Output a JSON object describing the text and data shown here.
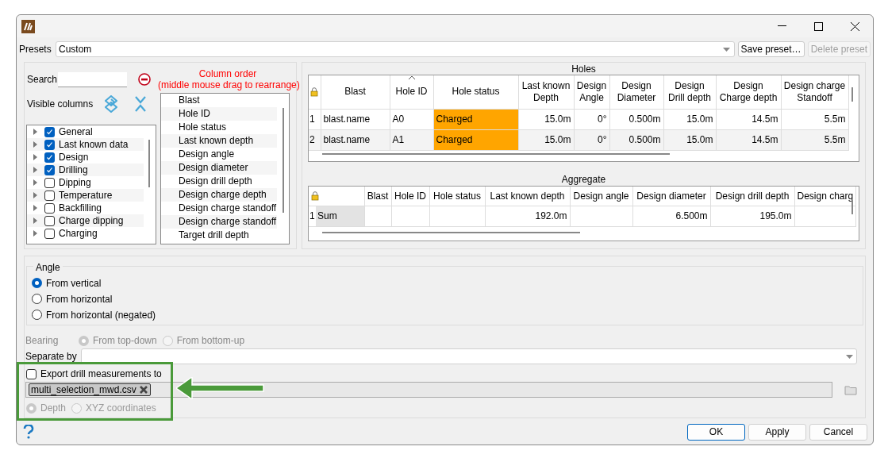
{
  "presets": {
    "label": "Presets",
    "value": "Custom",
    "buttons": [
      {
        "label": "Save preset…",
        "disabled": false
      },
      {
        "label": "Delete preset",
        "disabled": true
      }
    ]
  },
  "column_chooser": {
    "search_label": "Search",
    "visible_label": "Visible columns",
    "order_title": [
      "Column order",
      "(middle mouse drag to rearrange)"
    ],
    "groups": [
      {
        "label": "General",
        "checked": true
      },
      {
        "label": "Last known data",
        "checked": true
      },
      {
        "label": "Design",
        "checked": true
      },
      {
        "label": "Drilling",
        "checked": true
      },
      {
        "label": "Dipping",
        "checked": false
      },
      {
        "label": "Temperature",
        "checked": false
      },
      {
        "label": "Backfilling",
        "checked": false
      },
      {
        "label": "Charge dipping",
        "checked": false
      },
      {
        "label": "Charging",
        "checked": false
      }
    ],
    "order": [
      "Blast",
      "Hole ID",
      "Hole status",
      "Last known depth",
      "Design angle",
      "Design diameter",
      "Design drill depth",
      "Design charge depth",
      "Design charge standoff",
      "Design charge standoff",
      "Target drill depth"
    ]
  },
  "holes": {
    "title": "Holes",
    "columns": [
      {
        "label": "Blast",
        "sorted": false
      },
      {
        "label": "Hole ID",
        "sorted": true
      },
      {
        "label": "Hole status",
        "sorted": false
      },
      {
        "label": "Last known\nDepth",
        "sorted": false
      },
      {
        "label": "Design\nAngle",
        "sorted": false
      },
      {
        "label": "Design\nDiameter",
        "sorted": false
      },
      {
        "label": "Design\nDrill depth",
        "sorted": false
      },
      {
        "label": "Design\nCharge depth",
        "sorted": false
      },
      {
        "label": "Design charge\nStandoff",
        "sorted": false
      }
    ],
    "rows": [
      {
        "index": "1",
        "color": "#ffa500",
        "cells": [
          "blast.name",
          "A0",
          "Charged",
          "15.0m",
          "0°",
          "0.500m",
          "15.0m",
          "14.5m",
          "5.5m"
        ]
      },
      {
        "index": "2",
        "color": "#ffa500",
        "cells": [
          "blast.name",
          "A1",
          "Charged",
          "15.0m",
          "0°",
          "0.500m",
          "15.0m",
          "14.5m",
          "5.5m"
        ]
      }
    ]
  },
  "aggregate": {
    "title": "Aggregate",
    "columns": [
      "Blast",
      "Hole ID",
      "Hole status",
      "Last known depth",
      "Design angle",
      "Design diameter",
      "Design drill depth",
      "Design charg"
    ],
    "rows": [
      {
        "index": "1",
        "label": "Sum",
        "cells": [
          "",
          "",
          "",
          "192.0m",
          "",
          "6.500m",
          "195.0m",
          ""
        ]
      }
    ]
  },
  "angle": {
    "title": "Angle",
    "options": [
      {
        "label": "From vertical",
        "selected": true
      },
      {
        "label": "From horizontal",
        "selected": false
      },
      {
        "label": "From horizontal (negated)",
        "selected": false
      }
    ]
  },
  "bearing": {
    "label": "Bearing",
    "disabled": true,
    "options": [
      {
        "label": "From top-down",
        "selected": true
      },
      {
        "label": "From bottom-up",
        "selected": false
      }
    ]
  },
  "separate_by": {
    "label": "Separate by"
  },
  "export": {
    "label": "Export drill measurements to",
    "checked": false,
    "file": "multi_selection_mwd.csv",
    "disabled": true,
    "options": [
      {
        "label": "Depth",
        "selected": true
      },
      {
        "label": "XYZ coordinates",
        "selected": false
      }
    ]
  },
  "buttons": [
    {
      "label": "OK",
      "default": true
    },
    {
      "label": "Apply",
      "default": false
    },
    {
      "label": "Cancel",
      "default": false
    }
  ]
}
